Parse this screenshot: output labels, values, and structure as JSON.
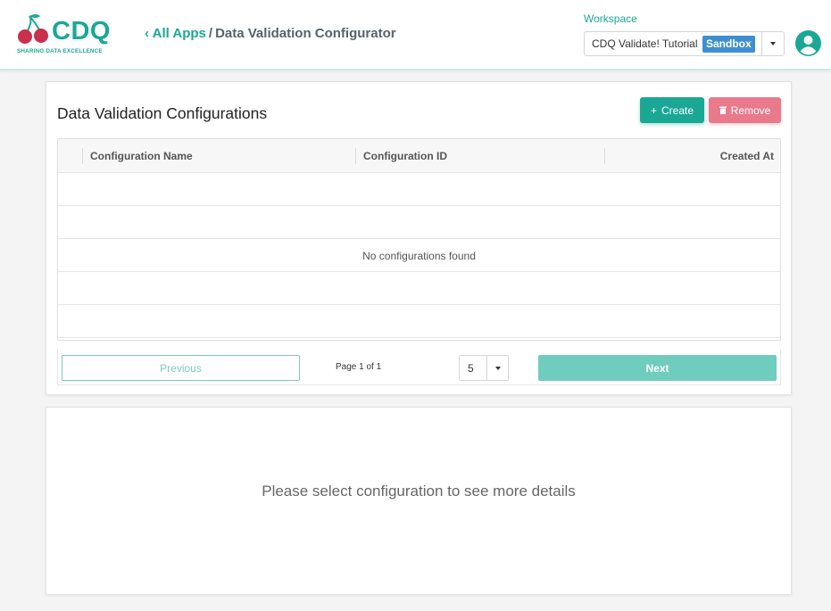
{
  "brand": {
    "name": "CDQ",
    "tagline": "SHARING DATA EXCELLENCE",
    "primary_color": "#1aa895",
    "cherry_color": "#c8304d"
  },
  "breadcrumb": {
    "back_label": "All Apps",
    "separator": "/",
    "current": "Data Validation Configurator"
  },
  "workspace": {
    "label": "Workspace",
    "selected": "CDQ Validate! Tutorial",
    "badge": "Sandbox"
  },
  "user": {
    "icon": "user-avatar-icon"
  },
  "configurations": {
    "title": "Data Validation Configurations",
    "create_label": "Create",
    "remove_label": "Remove",
    "columns": [
      "Configuration Name",
      "Configuration ID",
      "Created At"
    ],
    "rows": [],
    "empty_message": "No configurations found"
  },
  "pagination": {
    "previous_label": "Previous",
    "page_info": "Page 1 of 1",
    "page_size": "5",
    "next_label": "Next"
  },
  "details": {
    "placeholder": "Please select configuration to see more details"
  }
}
